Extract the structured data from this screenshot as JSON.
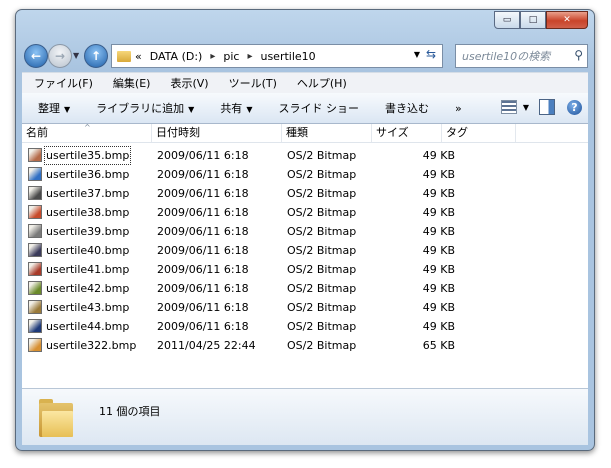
{
  "window": {
    "caption_buttons": {
      "minimize": "▭",
      "maximize": "□",
      "close": "✕"
    }
  },
  "nav": {
    "address_segments": [
      "«",
      "DATA (D:)",
      "pic",
      "usertile10"
    ],
    "search_placeholder": "usertile10の検索"
  },
  "menu": [
    "ファイル(F)",
    "編集(E)",
    "表示(V)",
    "ツール(T)",
    "ヘルプ(H)"
  ],
  "commands": [
    {
      "label": "整理",
      "dropdown": true
    },
    {
      "label": "ライブラリに追加",
      "dropdown": true
    },
    {
      "label": "共有",
      "dropdown": true
    },
    {
      "label": "スライド ショー",
      "dropdown": false
    },
    {
      "label": "書き込む",
      "dropdown": false
    },
    {
      "label": "»",
      "dropdown": false
    }
  ],
  "columns": [
    "名前",
    "日付時刻",
    "種類",
    "サイズ",
    "タグ"
  ],
  "files": [
    {
      "name": "usertile35.bmp",
      "date": "2009/06/11 6:18",
      "type": "OS/2 Bitmap",
      "size": "49 KB",
      "icon_color": "#b56a48"
    },
    {
      "name": "usertile36.bmp",
      "date": "2009/06/11 6:18",
      "type": "OS/2 Bitmap",
      "size": "49 KB",
      "icon_color": "#2f6fc4"
    },
    {
      "name": "usertile37.bmp",
      "date": "2009/06/11 6:18",
      "type": "OS/2 Bitmap",
      "size": "49 KB",
      "icon_color": "#4a4a4a"
    },
    {
      "name": "usertile38.bmp",
      "date": "2009/06/11 6:18",
      "type": "OS/2 Bitmap",
      "size": "49 KB",
      "icon_color": "#c84a2a"
    },
    {
      "name": "usertile39.bmp",
      "date": "2009/06/11 6:18",
      "type": "OS/2 Bitmap",
      "size": "49 KB",
      "icon_color": "#7a7a7a"
    },
    {
      "name": "usertile40.bmp",
      "date": "2009/06/11 6:18",
      "type": "OS/2 Bitmap",
      "size": "49 KB",
      "icon_color": "#3a3a5a"
    },
    {
      "name": "usertile41.bmp",
      "date": "2009/06/11 6:18",
      "type": "OS/2 Bitmap",
      "size": "49 KB",
      "icon_color": "#a83a28"
    },
    {
      "name": "usertile42.bmp",
      "date": "2009/06/11 6:18",
      "type": "OS/2 Bitmap",
      "size": "49 KB",
      "icon_color": "#6a8a2a"
    },
    {
      "name": "usertile43.bmp",
      "date": "2009/06/11 6:18",
      "type": "OS/2 Bitmap",
      "size": "49 KB",
      "icon_color": "#9a7a3a"
    },
    {
      "name": "usertile44.bmp",
      "date": "2009/06/11 6:18",
      "type": "OS/2 Bitmap",
      "size": "49 KB",
      "icon_color": "#1e3a7a"
    },
    {
      "name": "usertile322.bmp",
      "date": "2011/04/25 22:44",
      "type": "OS/2 Bitmap",
      "size": "65 KB",
      "icon_color": "#d89030"
    }
  ],
  "status": {
    "item_count": "11 個の項目"
  }
}
